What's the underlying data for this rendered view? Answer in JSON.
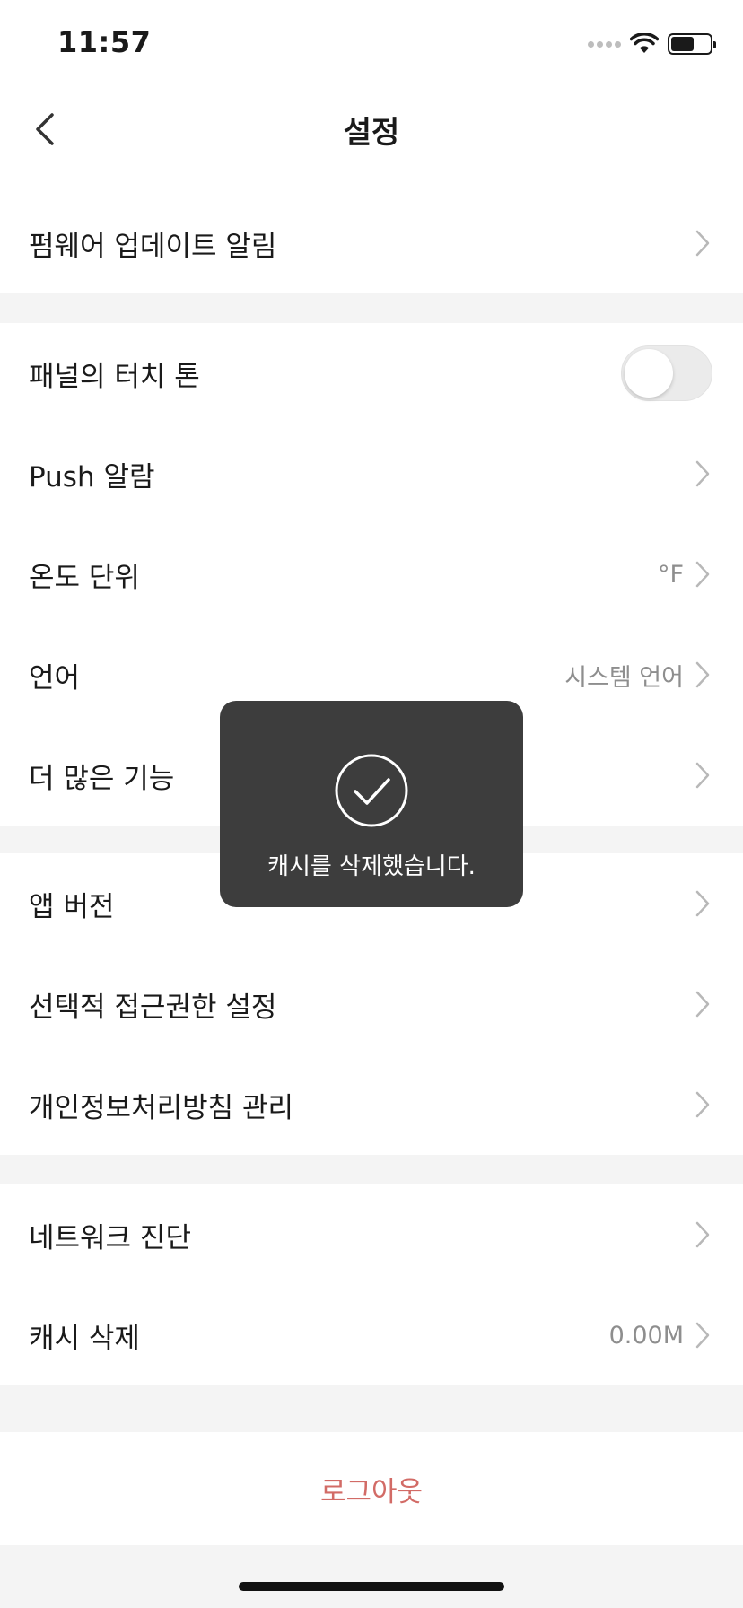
{
  "status_bar": {
    "time": "11:57"
  },
  "nav": {
    "title": "설정"
  },
  "group1": [
    {
      "label": "펌웨어 업데이트 알림"
    }
  ],
  "group2": {
    "touch_tone": {
      "label": "패널의 터치 톤",
      "enabled": false
    },
    "push": {
      "label": "Push 알람"
    },
    "temp_unit": {
      "label": "온도 단위",
      "value": "°F"
    },
    "language": {
      "label": "언어",
      "value": "시스템 언어"
    },
    "more": {
      "label": "더 많은 기능"
    }
  },
  "group3": [
    {
      "label": "앱 버전"
    },
    {
      "label": "선택적 접근권한 설정"
    },
    {
      "label": "개인정보처리방침 관리"
    }
  ],
  "group4": {
    "network": {
      "label": "네트워크 진단"
    },
    "cache": {
      "label": "캐시 삭제",
      "value": "0.00M"
    }
  },
  "logout": {
    "label": "로그아웃"
  },
  "toast": {
    "message": "캐시를 삭제했습니다.",
    "icon": "check-circle-icon"
  },
  "colors": {
    "logout": "#d26b66",
    "toast_bg": "#3d3d3d",
    "divider": "#f4f4f4"
  }
}
